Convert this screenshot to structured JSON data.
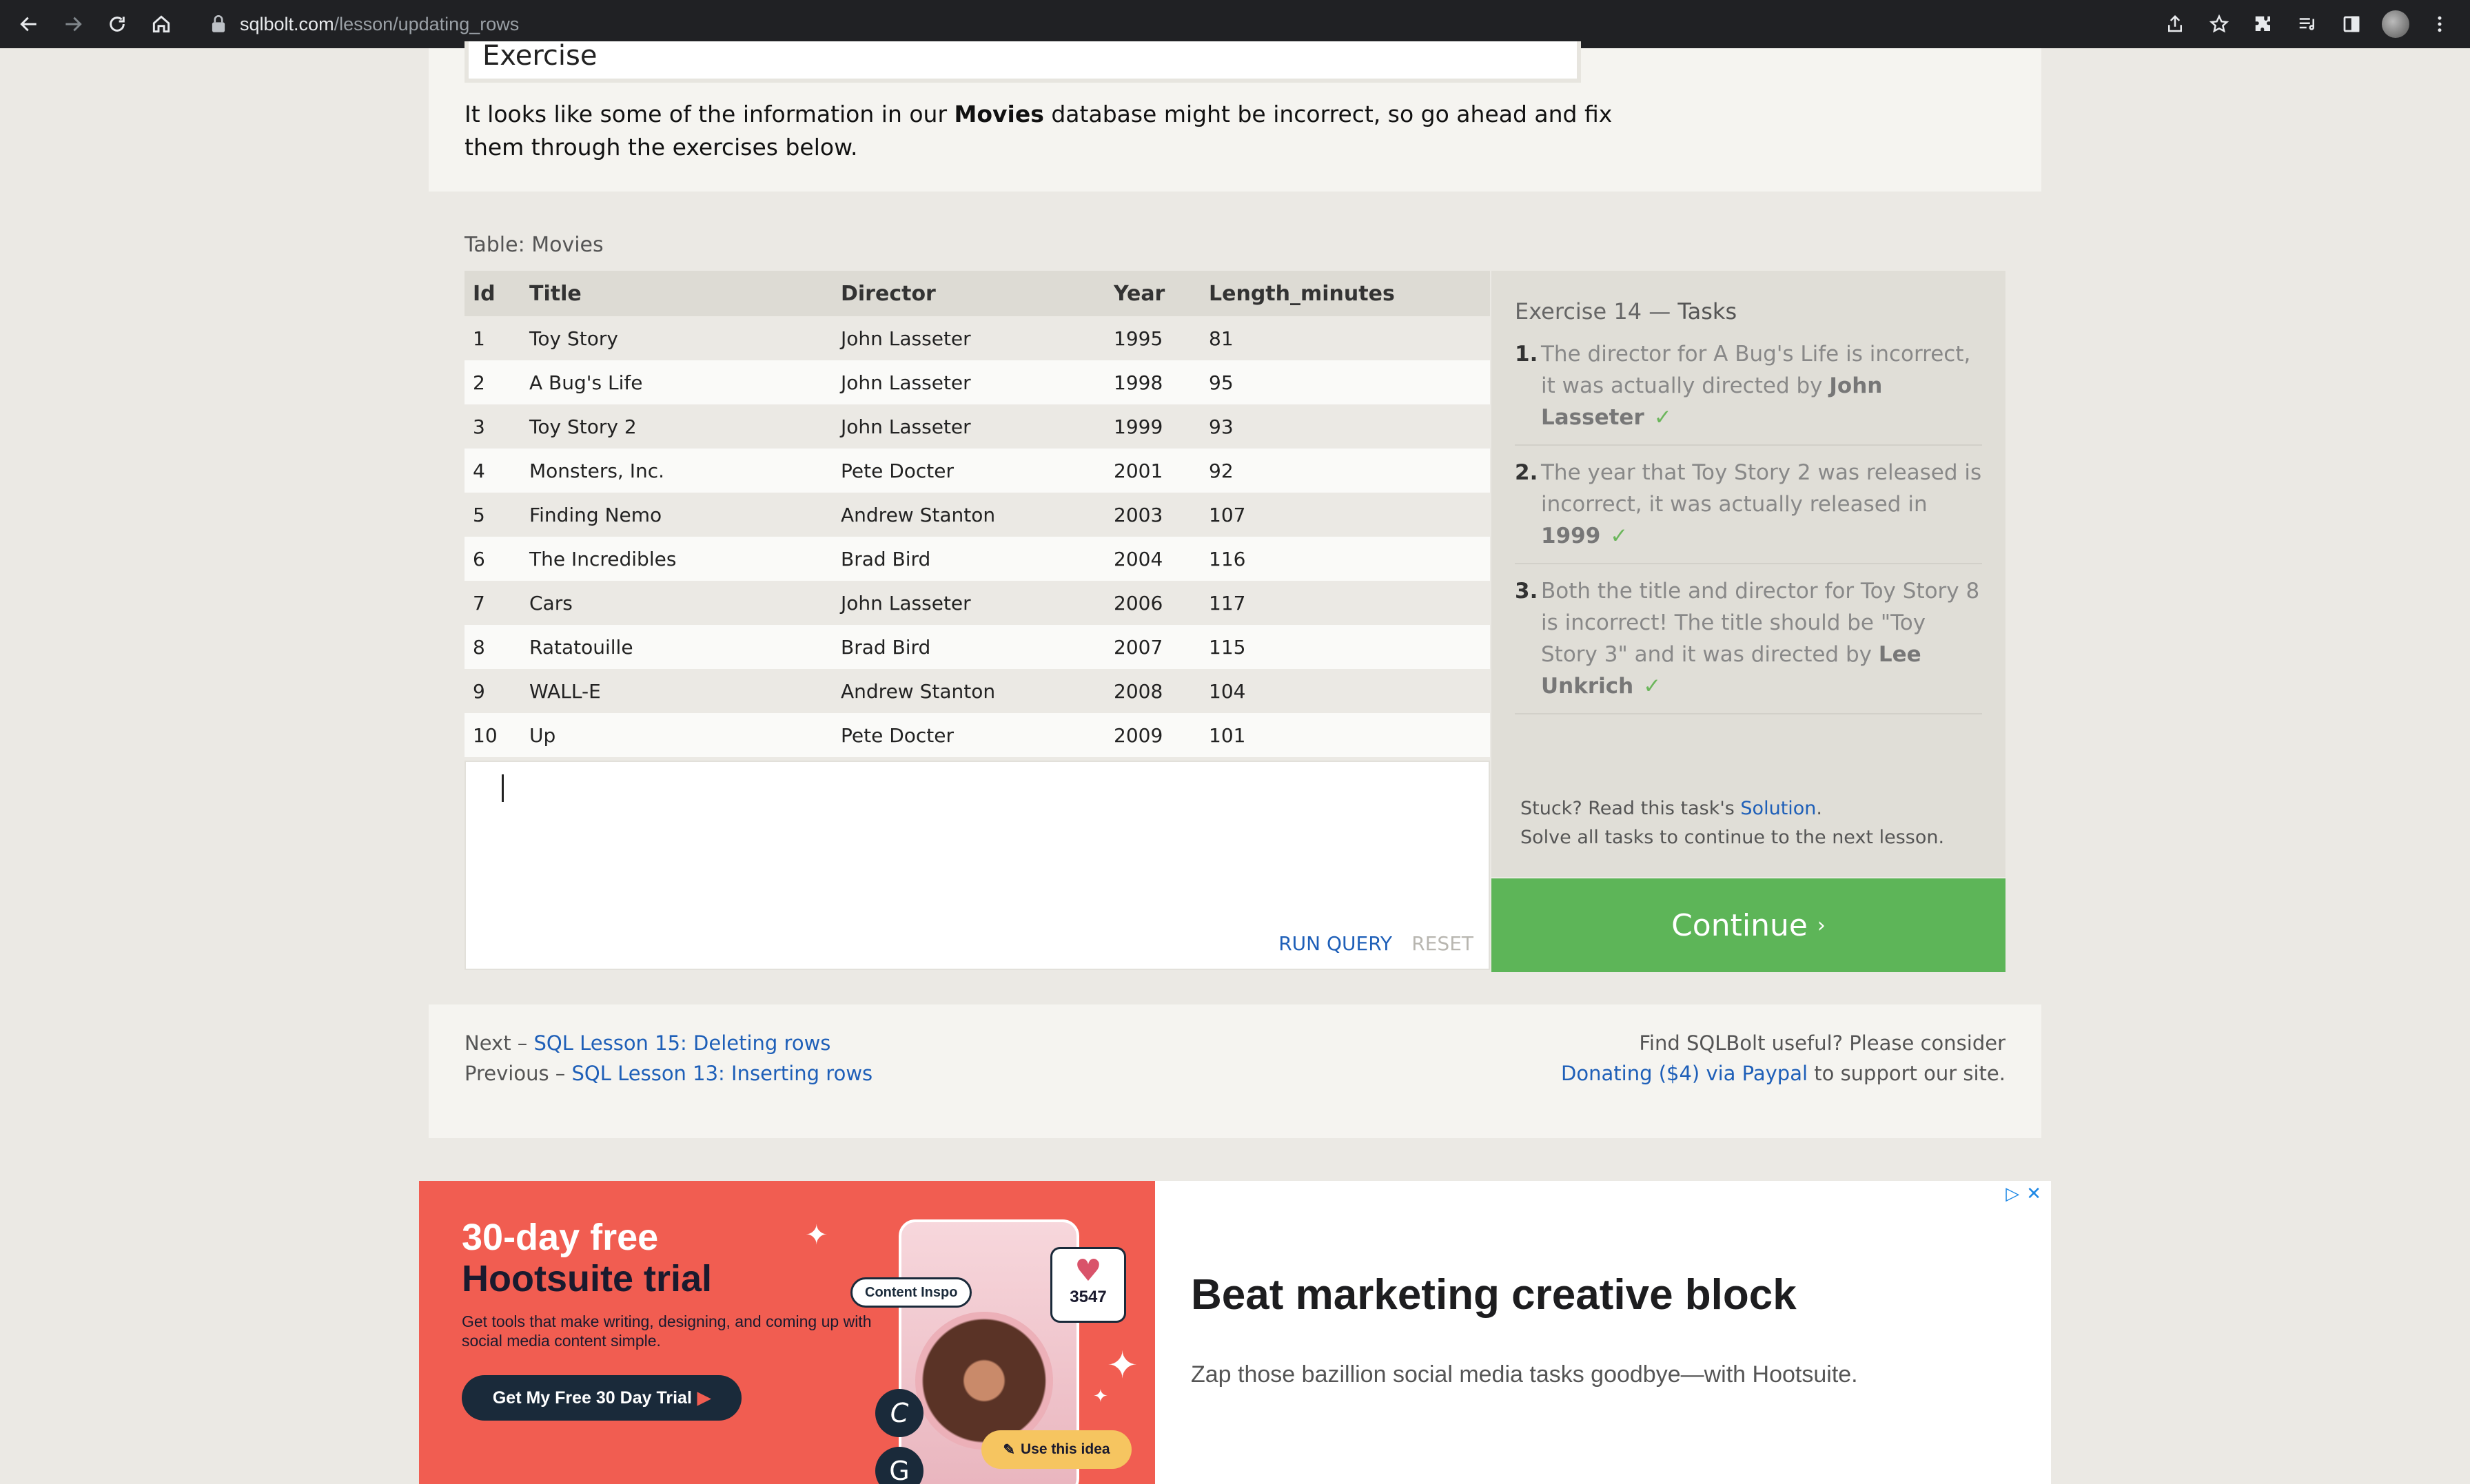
{
  "browser": {
    "url_host": "sqlbolt.com",
    "url_path": "/lesson/updating_rows"
  },
  "exercise": {
    "tab_label": "Exercise",
    "intro_before": "It looks like some of the information in our ",
    "intro_bold": "Movies",
    "intro_after": " database might be incorrect, so go ahead and fix them through the exercises below."
  },
  "table": {
    "label": "Table: Movies",
    "columns": [
      "Id",
      "Title",
      "Director",
      "Year",
      "Length_minutes"
    ],
    "rows": [
      [
        "1",
        "Toy Story",
        "John Lasseter",
        "1995",
        "81"
      ],
      [
        "2",
        "A Bug's Life",
        "John Lasseter",
        "1998",
        "95"
      ],
      [
        "3",
        "Toy Story 2",
        "John Lasseter",
        "1999",
        "93"
      ],
      [
        "4",
        "Monsters, Inc.",
        "Pete Docter",
        "2001",
        "92"
      ],
      [
        "5",
        "Finding Nemo",
        "Andrew Stanton",
        "2003",
        "107"
      ],
      [
        "6",
        "The Incredibles",
        "Brad Bird",
        "2004",
        "116"
      ],
      [
        "7",
        "Cars",
        "John Lasseter",
        "2006",
        "117"
      ],
      [
        "8",
        "Ratatouille",
        "Brad Bird",
        "2007",
        "115"
      ],
      [
        "9",
        "WALL-E",
        "Andrew Stanton",
        "2008",
        "104"
      ],
      [
        "10",
        "Up",
        "Pete Docter",
        "2009",
        "101"
      ]
    ]
  },
  "editor": {
    "run_label": "RUN QUERY",
    "reset_label": "RESET"
  },
  "tasks": {
    "heading_prefix": "Exercise 14 — ",
    "heading_title": "Tasks",
    "items": [
      {
        "num": "1.",
        "text": "The director for A Bug's Life is incorrect, it was actually directed by ",
        "bold": "John Lasseter",
        "check": "✓"
      },
      {
        "num": "2.",
        "text": "The year that Toy Story 2 was released is incorrect, it was actually released in ",
        "bold": "1999",
        "check": "✓"
      },
      {
        "num": "3.",
        "text": "Both the title and director for Toy Story 8 is incorrect! The title should be \"Toy Story 3\" and it was directed by ",
        "bold": "Lee Unkrich",
        "check": "✓"
      }
    ],
    "stuck_prefix": "Stuck? Read this task's ",
    "solution_link": "Solution",
    "stuck_suffix": ".",
    "solve_all": "Solve all tasks to continue to the next lesson.",
    "continue_label": "Continue",
    "continue_chevron": "›"
  },
  "lesson_nav": {
    "next_prefix": "Next – ",
    "next_link": "SQL Lesson 15: Deleting rows",
    "prev_prefix": "Previous – ",
    "prev_link": "SQL Lesson 13: Inserting rows"
  },
  "support": {
    "line1": "Find SQLBolt useful? Please consider",
    "link": "Donating ($4) via Paypal",
    "line2_suffix": " to support our site."
  },
  "ad": {
    "title_line1": "30-day free",
    "title_line2": "Hootsuite trial",
    "subtitle": "Get tools that make writing, designing, and coming up with social media content simple.",
    "cta": "Get My Free 30 Day Trial",
    "pill": "Content Inspo",
    "likes": "3547",
    "use_idea": "Use this idea",
    "headline": "Beat marketing creative block",
    "subline": "Zap those bazillion social media tasks goodbye—with Hootsuite."
  },
  "colors": {
    "accent_blue": "#1e5fb8",
    "continue_green": "#5db558",
    "check_green": "#6bb65b",
    "ad_coral": "#f15d51"
  }
}
